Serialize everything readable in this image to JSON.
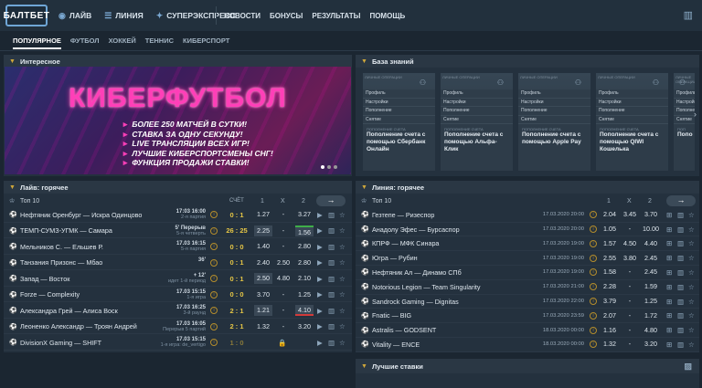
{
  "header": {
    "logo": "БАЛТБЕТ",
    "nav_main": [
      {
        "label": "ЛАЙВ",
        "icon": "broadcast-icon"
      },
      {
        "label": "ЛИНИЯ",
        "icon": "list-icon"
      },
      {
        "label": "СУПЕРЭКСПРЕСС",
        "icon": "star-icon"
      }
    ],
    "nav_secondary": [
      "НОВОСТИ",
      "БОНУСЫ",
      "РЕЗУЛЬТАТЫ",
      "ПОМОЩЬ"
    ]
  },
  "subnav": {
    "items": [
      "ПОПУЛЯРНОЕ",
      "ФУТБОЛ",
      "ХОККЕЙ",
      "ТЕННИС",
      "КИБЕРСПОРТ"
    ],
    "active": "ПОПУЛЯРНОЕ"
  },
  "interesting": {
    "title": "Интересное",
    "banner_title": "КИБЕРФУТБОЛ",
    "bullets": [
      "БОЛЕЕ 250 МАТЧЕЙ В СУТКИ!",
      "СТАВКА ЗА ОДНУ СЕКУНДУ!",
      "LIVE ТРАНСЛЯЦИИ ВСЕХ ИГР!",
      "ЛУЧШИЕ КИБЕРСПОРТСМЕНЫ СНГ!",
      "ФУНКЦИЯ ПРОДАЖИ СТАВКИ!"
    ]
  },
  "knowledge": {
    "title": "База знаний",
    "cards": [
      {
        "cap": "ЛИЧНЫЕ ОПЕРАЦИИ",
        "options": [
          "Профиль",
          "Настройки",
          "Пополнение",
          "Снятие"
        ],
        "label": "ПОПОЛНЕНИЕ СЧЕТА",
        "title": "Пополнение счета с помощью Сбербанк Онлайн"
      },
      {
        "cap": "ЛИЧНЫЕ ОПЕРАЦИИ",
        "options": [
          "Профиль",
          "Настройки",
          "Пополнение",
          "Снятие"
        ],
        "label": "ПОПОЛНЕНИЕ СЧЕТА",
        "title": "Пополнение счета с помощью Альфа-Клик"
      },
      {
        "cap": "ЛИЧНЫЕ ОПЕРАЦИИ",
        "options": [
          "Профиль",
          "Настройки",
          "Пополнение",
          "Снятие"
        ],
        "label": "ПОПОЛНЕНИЕ СЧЕТА",
        "title": "Пополнение счета с помощью Apple Pay"
      },
      {
        "cap": "ЛИЧНЫЕ ОПЕРАЦИИ",
        "options": [
          "Профиль",
          "Настройки",
          "Пополнение",
          "Снятие"
        ],
        "label": "ПОПОЛНЕНИЕ СЧЕТА",
        "title": "Пополнение счета с помощью QIWI Кошелька"
      },
      {
        "cap": "ЛИЧНЫЕ ОПЕРАЦИИ",
        "options": [
          "Профиль",
          "Настройки",
          "Пополнение",
          "Снятие"
        ],
        "label": "ПОП",
        "title": "Попо"
      }
    ]
  },
  "live": {
    "title": "Лайв: горячее",
    "top_label": "Топ 10",
    "cols": {
      "score": "СЧЁТ",
      "c1": "1",
      "cx": "X",
      "c2": "2"
    },
    "rows": [
      {
        "teams": "Нефтяник Оренбург — Искра Одинцово",
        "time": "17:03 16:00",
        "sub": "2-я партия",
        "score": "0 : 1",
        "o1": "1.27",
        "ox": "-",
        "o2": "3.27"
      },
      {
        "teams": "ТЕМП-СУМЗ-УГМК — Самара",
        "time": "5' Перерыв",
        "sub": "5-я четверть",
        "score": "26 : 25",
        "o1": "2.25",
        "ox": "-",
        "o2": "1.56"
      },
      {
        "teams": "Мельников С. — Ельшев Р.",
        "time": "17.03 16:15",
        "sub": "5-я партия",
        "score": "0 : 0",
        "o1": "1.40",
        "ox": "-",
        "o2": "2.80"
      },
      {
        "teams": "Танзания Призонс — Мбао",
        "time": "36'",
        "sub": "",
        "score": "0 : 1",
        "o1": "2.40",
        "ox": "2.50",
        "o2": "2.80"
      },
      {
        "teams": "Запад — Восток",
        "time": "+ 12'",
        "sub": "идет 1-й период",
        "score": "0 : 1",
        "o1": "2.50",
        "ox": "4.80",
        "o2": "2.10"
      },
      {
        "teams": "Forze — Complexity",
        "time": "17.03 15:15",
        "sub": "1-я игра",
        "score": "0 : 0",
        "o1": "3.70",
        "ox": "-",
        "o2": "1.25"
      },
      {
        "teams": "Александра Грей — Алиса Воск",
        "time": "17.03 16:25",
        "sub": "3-й раунд",
        "score": "2 : 1",
        "o1": "1.21",
        "ox": "-",
        "o2": "4.10"
      },
      {
        "teams": "Леоненко Александр — Троян Андрей",
        "time": "17.03 16:05",
        "sub": "Перерыв 5 партий",
        "score": "2 : 1",
        "o1": "1.32",
        "ox": "-",
        "o2": "3.20"
      },
      {
        "teams": "DivisionX Gaming — SHIFT",
        "time": "17.03 15:15",
        "sub": "1-я игра: de_vertigo",
        "score": "1 : 0",
        "o1": "",
        "ox": "",
        "o2": ""
      }
    ]
  },
  "line": {
    "title": "Линия: горячее",
    "top_label": "Топ 10",
    "cols": {
      "c1": "1",
      "cx": "X",
      "c2": "2"
    },
    "rows": [
      {
        "teams": "Гезтепе — Ризеспор",
        "date": "17.03.2020 20:00",
        "o1": "2.04",
        "ox": "3.45",
        "o2": "3.70"
      },
      {
        "teams": "Анадолу Эфес — Бурсаспор",
        "date": "17.03.2020 20:00",
        "o1": "1.05",
        "ox": "-",
        "o2": "10.00"
      },
      {
        "teams": "КПРФ — МФК Синара",
        "date": "17.03.2020 19:00",
        "o1": "1.57",
        "ox": "4.50",
        "o2": "4.40"
      },
      {
        "teams": "Югра — Рубин",
        "date": "17.03.2020 19:00",
        "o1": "2.55",
        "ox": "3.80",
        "o2": "2.45"
      },
      {
        "teams": "Нефтяник Ал — Динамо СПб",
        "date": "17.03.2020 19:00",
        "o1": "1.58",
        "ox": "-",
        "o2": "2.45"
      },
      {
        "teams": "Notorious Legion — Team Singularity",
        "date": "17.03.2020 21:00",
        "o1": "2.28",
        "ox": "-",
        "o2": "1.59"
      },
      {
        "teams": "Sandrock Gaming — Dignitas",
        "date": "17.03.2020 22:00",
        "o1": "3.79",
        "ox": "-",
        "o2": "1.25"
      },
      {
        "teams": "Fnatic — BIG",
        "date": "17.03.2020 23:59",
        "o1": "2.07",
        "ox": "-",
        "o2": "1.72"
      },
      {
        "teams": "Astralis — GODSENT",
        "date": "18.03.2020 00:00",
        "o1": "1.16",
        "ox": "-",
        "o2": "4.80"
      },
      {
        "teams": "Vitality — ENCE",
        "date": "18.03.2020 00:00",
        "o1": "1.32",
        "ox": "-",
        "o2": "3.20"
      }
    ]
  },
  "best": {
    "title": "Лучшие ставки"
  }
}
